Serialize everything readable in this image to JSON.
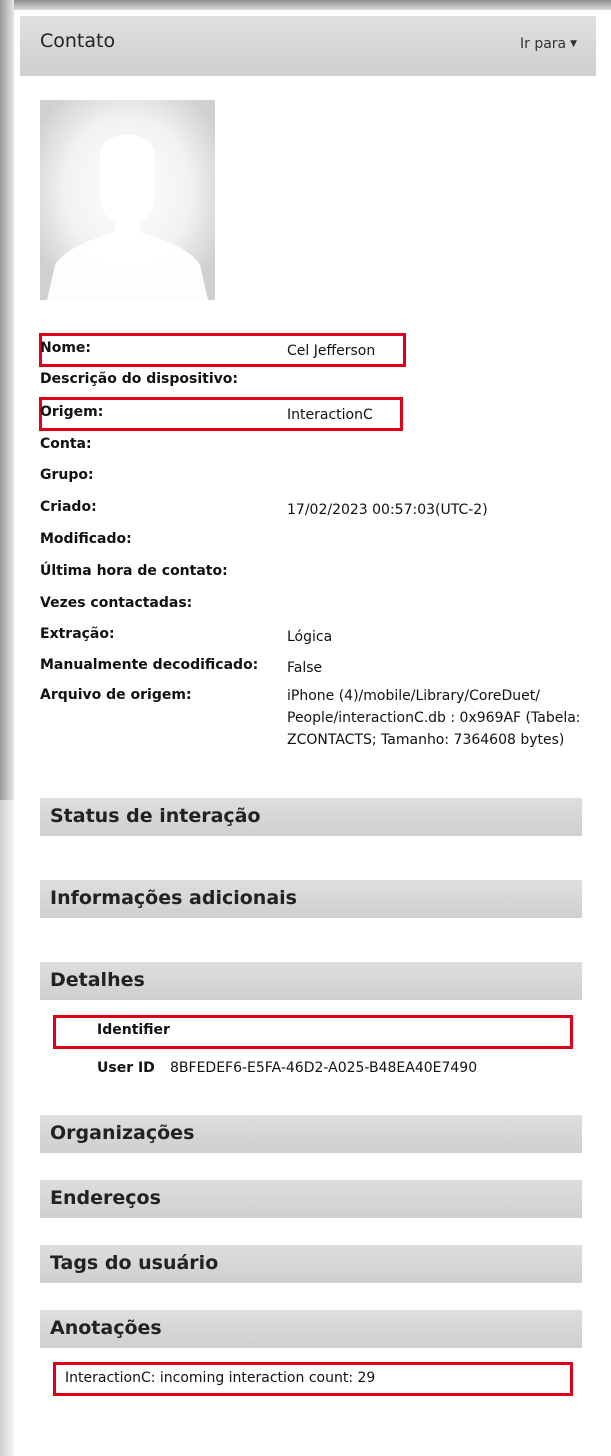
{
  "header": {
    "title": "Contato",
    "goto_label": "Ir para"
  },
  "properties": [
    {
      "label": "Nome:",
      "value": "Cel Jefferson"
    },
    {
      "label": "Descrição do dispositivo:",
      "value": ""
    },
    {
      "label": "Origem:",
      "value": "InteractionC"
    },
    {
      "label": "Conta:",
      "value": ""
    },
    {
      "label": "Grupo:",
      "value": ""
    },
    {
      "label": "Criado:",
      "value": "17/02/2023 00:57:03(UTC-2)"
    },
    {
      "label": "Modificado:",
      "value": ""
    },
    {
      "label": "Última hora de contato:",
      "value": ""
    },
    {
      "label": "Vezes contactadas:",
      "value": ""
    },
    {
      "label": "Extração:",
      "value": "Lógica"
    },
    {
      "label": "Manualmente decodificado:",
      "value": "False"
    },
    {
      "label": "Arquivo de origem:",
      "value": "iPhone (4)/mobile/Library/CoreDuet/ People/interactionC.db : 0x969AF (Tabela: ZCONTACTS; Tamanho: 7364608 bytes)"
    }
  ],
  "sections": {
    "status": "Status de interação",
    "info": "Informações adicionais",
    "details": "Detalhes",
    "orgs": "Organizações",
    "addresses": "Endereços",
    "tags": "Tags do usuário",
    "notes": "Anotações"
  },
  "details": {
    "identifier_label": "Identifier",
    "identifier_value": "",
    "userid_label": "User ID",
    "userid_value": "8BFEDEF6-E5FA-46D2-A025-B48EA40E7490"
  },
  "notes": {
    "text": "InteractionC: incoming interaction count:  29"
  },
  "colors": {
    "highlight": "#e0001a",
    "section_bg": "#d6d6d6"
  },
  "icons": {
    "goto_caret": "caret-down-icon",
    "avatar": "person-silhouette-icon"
  }
}
